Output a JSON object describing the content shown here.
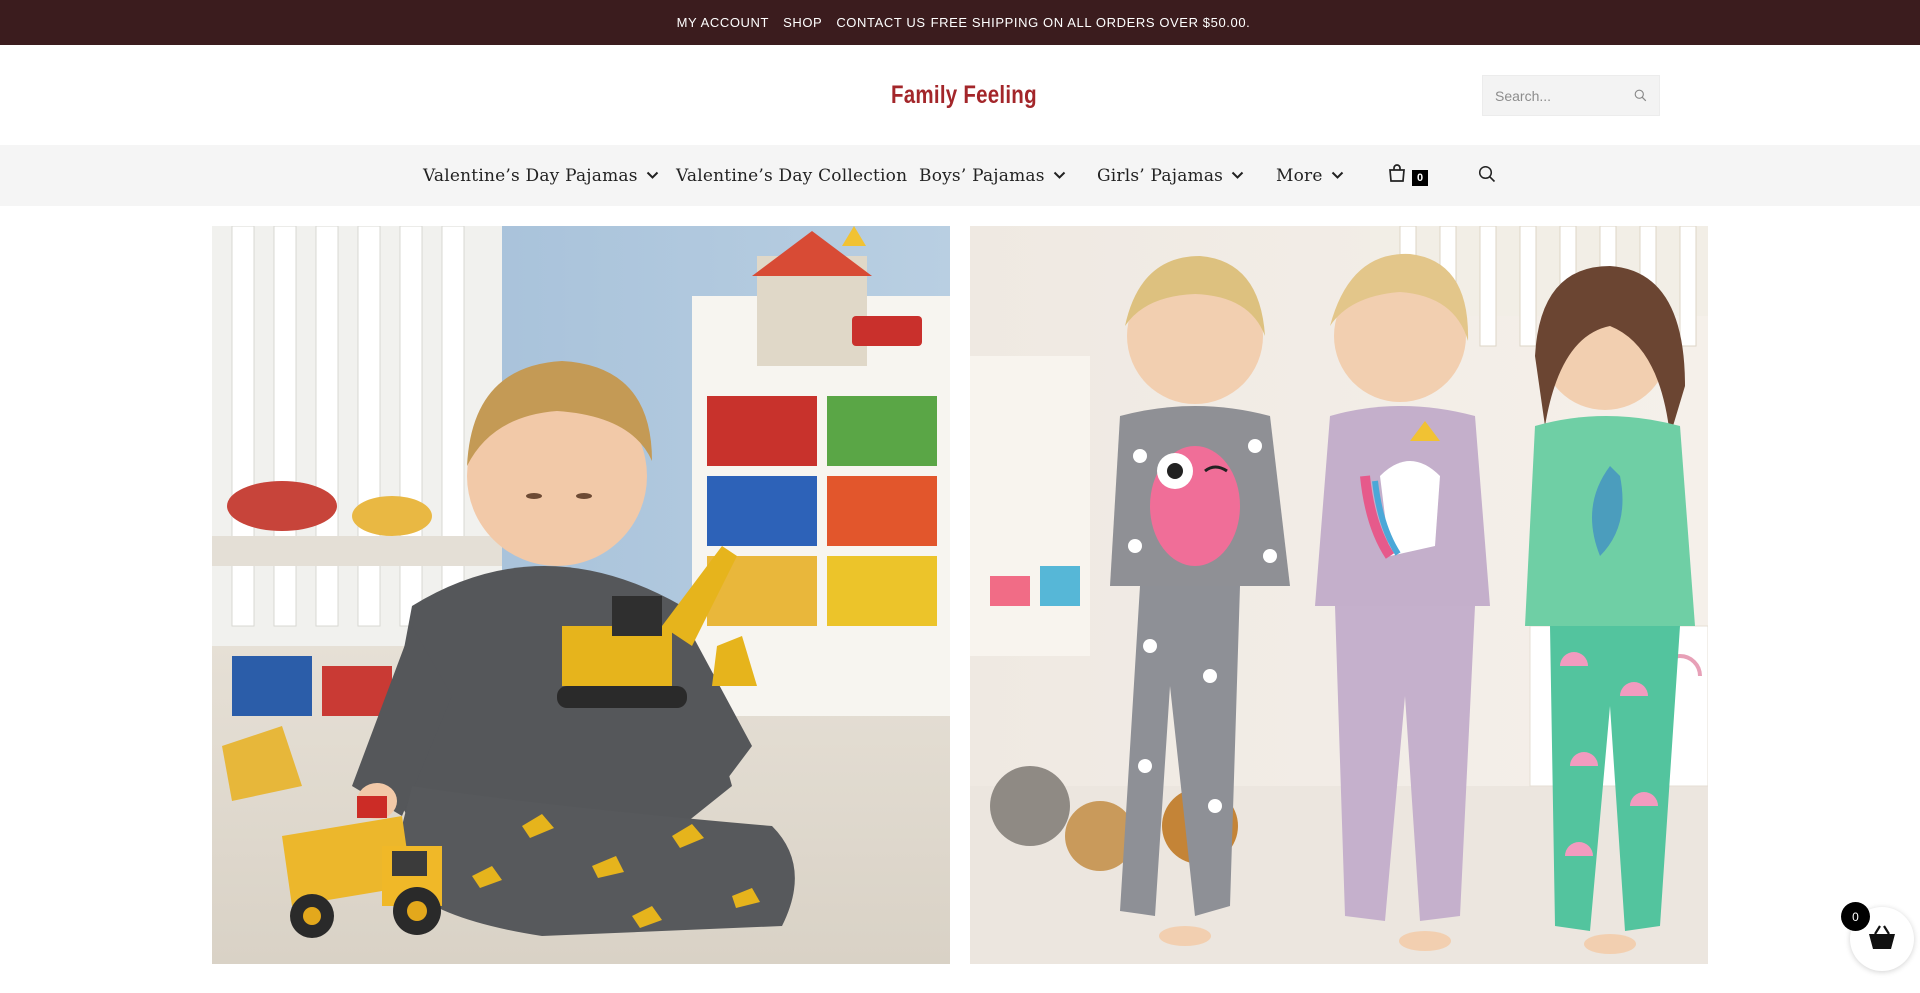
{
  "topbar": {
    "links": [
      "MY ACCOUNT",
      "SHOP",
      "CONTACT US"
    ],
    "promo": "FREE SHIPPING ON ALL ORDERS OVER $50.00."
  },
  "header": {
    "logo": "Family Feeling",
    "search_placeholder": "Search...",
    "search_icon": "search-icon"
  },
  "nav": {
    "items": [
      {
        "label": "Valentine’s Day Pajamas",
        "has_dropdown": true
      },
      {
        "label": "Valentine’s Day Collection",
        "has_dropdown": false
      },
      {
        "label": "Boys’ Pajamas",
        "has_dropdown": true
      },
      {
        "label": "Girls’ Pajamas",
        "has_dropdown": true
      },
      {
        "label": "More",
        "has_dropdown": true
      }
    ],
    "cart_count": "0",
    "cart_icon": "shopping-bag-icon",
    "search_icon": "search-icon"
  },
  "hero": {
    "left_image": "boy-in-excavator-pajamas-photo",
    "right_image": "three-girls-in-owl-unicorn-mermaid-pajamas-photo"
  },
  "floating_cart": {
    "count": "0",
    "icon": "basket-icon"
  },
  "colors": {
    "topbar_bg": "#3b1c1e",
    "logo": "#a3262a",
    "navbar_bg": "#f5f5f5",
    "badge": "#000000"
  }
}
